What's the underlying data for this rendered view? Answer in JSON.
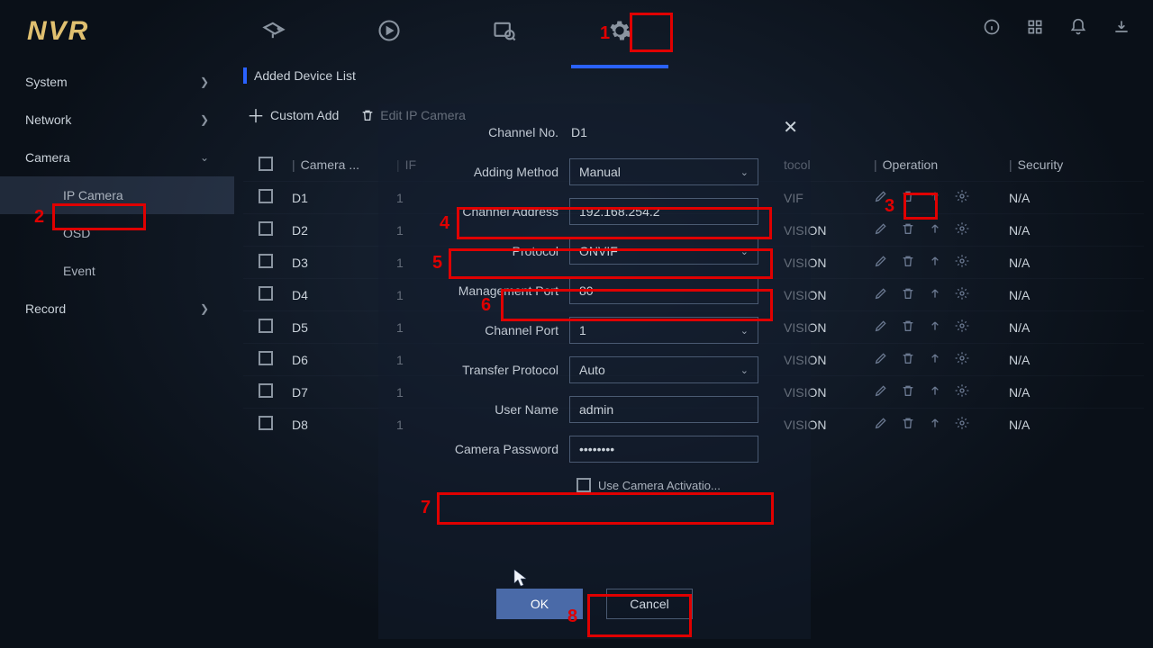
{
  "logo": "NVR",
  "sidebar": {
    "system": "System",
    "network": "Network",
    "camera": "Camera",
    "ip_camera": "IP Camera",
    "osd": "OSD",
    "event": "Event",
    "record": "Record"
  },
  "content": {
    "header": "Added Device List",
    "custom_add": "Custom Add",
    "edit_ip": "Edit IP Camera",
    "columns": {
      "camera": "Camera ...",
      "ip_prefix": "IF",
      "protocol": "tocol",
      "operation": "Operation",
      "security": "Security"
    },
    "rows": [
      {
        "cam": "D1",
        "ip": "1",
        "proto": "VIF",
        "sec": "N/A"
      },
      {
        "cam": "D2",
        "ip": "1",
        "proto": "VISION",
        "sec": "N/A"
      },
      {
        "cam": "D3",
        "ip": "1",
        "proto": "VISION",
        "sec": "N/A"
      },
      {
        "cam": "D4",
        "ip": "1",
        "proto": "VISION",
        "sec": "N/A"
      },
      {
        "cam": "D5",
        "ip": "1",
        "proto": "VISION",
        "sec": "N/A"
      },
      {
        "cam": "D6",
        "ip": "1",
        "proto": "VISION",
        "sec": "N/A"
      },
      {
        "cam": "D7",
        "ip": "1",
        "proto": "VISION",
        "sec": "N/A"
      },
      {
        "cam": "D8",
        "ip": "1",
        "proto": "VISION",
        "sec": "N/A"
      }
    ]
  },
  "modal": {
    "channel_no_label": "Channel No.",
    "channel_no": "D1",
    "adding_method_label": "Adding Method",
    "adding_method": "Manual",
    "channel_address_label": "Channel Address",
    "channel_address": "192.168.254.2",
    "protocol_label": "Protocol",
    "protocol": "ONVIF",
    "mgmt_port_label": "Management Port",
    "mgmt_port": "80",
    "channel_port_label": "Channel Port",
    "channel_port": "1",
    "transfer_label": "Transfer Protocol",
    "transfer": "Auto",
    "user_label": "User Name",
    "user": "admin",
    "pwd_label": "Camera Password",
    "pwd": "••••••••",
    "activation": "Use Camera Activatio...",
    "ok": "OK",
    "cancel": "Cancel"
  },
  "annotations": [
    "1",
    "2",
    "3",
    "4",
    "5",
    "6",
    "7",
    "8"
  ]
}
